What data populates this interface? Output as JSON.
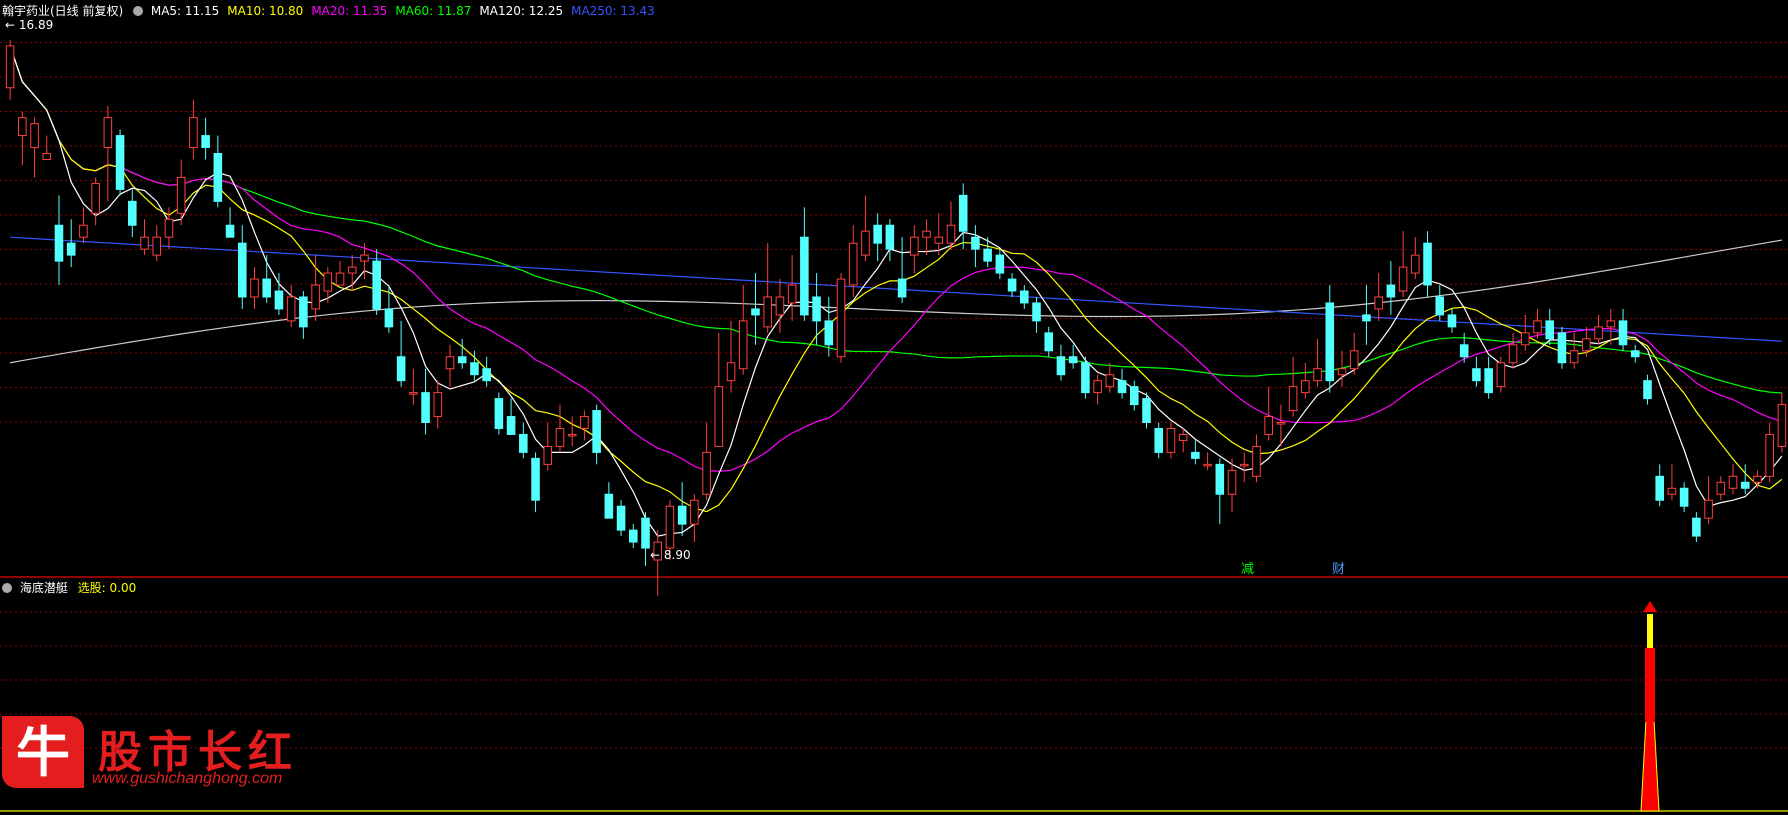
{
  "header": {
    "title": "翰宇药业(日线 前复权)",
    "ma": [
      {
        "label": "MA5: 11.15",
        "color": "#ffffff"
      },
      {
        "label": "MA10: 10.80",
        "color": "#ffff00"
      },
      {
        "label": "MA20: 11.35",
        "color": "#ff00ff"
      },
      {
        "label": "MA60: 11.87",
        "color": "#00ff00"
      },
      {
        "label": "MA120: 12.25",
        "color": "#ffffff"
      },
      {
        "label": "MA250: 13.43",
        "color": "#3355ff"
      }
    ]
  },
  "indicator": {
    "name": "海底潜艇",
    "select_label": "选股: 0.00"
  },
  "markers": {
    "high": "16.89",
    "low": "8.90",
    "event_1": "减",
    "event_2": "财"
  },
  "watermark": {
    "title": "股市长红",
    "badge": "牛",
    "url": "www.gushichanghong.com"
  },
  "colors": {
    "up": "#ff4040",
    "down": "#54ffff",
    "ma5": "#ffffff",
    "ma10": "#ffff00",
    "ma20": "#ff00ff",
    "ma60": "#00ff00",
    "ma120": "#cccccc",
    "ma250": "#3355ff",
    "grid": "#8b0000"
  },
  "chart_data": {
    "type": "candlestick",
    "ylim": [
      8.2,
      17.2
    ],
    "candles": [
      [
        16.1,
        16.8,
        16.9,
        15.9
      ],
      [
        15.3,
        15.6,
        15.7,
        14.8
      ],
      [
        15.1,
        15.5,
        15.6,
        14.6
      ],
      [
        14.9,
        15.0,
        15.3,
        14.9
      ],
      [
        13.8,
        13.2,
        14.3,
        12.8
      ],
      [
        13.5,
        13.3,
        13.9,
        13.1
      ],
      [
        13.6,
        13.8,
        14.1,
        13.5
      ],
      [
        14.0,
        14.5,
        14.6,
        13.8
      ],
      [
        15.1,
        15.6,
        15.8,
        14.2
      ],
      [
        15.3,
        14.4,
        15.4,
        14.3
      ],
      [
        14.2,
        13.8,
        14.4,
        13.6
      ],
      [
        13.4,
        13.6,
        13.9,
        13.3
      ],
      [
        13.3,
        13.6,
        13.8,
        13.2
      ],
      [
        13.6,
        13.9,
        14.1,
        13.4
      ],
      [
        14.0,
        14.6,
        14.9,
        13.8
      ],
      [
        15.1,
        15.6,
        15.9,
        14.9
      ],
      [
        15.3,
        15.1,
        15.6,
        14.9
      ],
      [
        15.0,
        14.2,
        15.3,
        14.1
      ],
      [
        13.8,
        13.6,
        14.1,
        13.6
      ],
      [
        13.5,
        12.6,
        13.8,
        12.4
      ],
      [
        12.6,
        12.9,
        13.1,
        12.4
      ],
      [
        12.9,
        12.6,
        13.3,
        12.5
      ],
      [
        12.7,
        12.4,
        13.0,
        12.3
      ],
      [
        12.2,
        12.6,
        12.8,
        12.1
      ],
      [
        12.6,
        12.1,
        12.7,
        11.9
      ],
      [
        12.4,
        12.8,
        13.3,
        12.2
      ],
      [
        12.7,
        13.0,
        13.1,
        12.5
      ],
      [
        12.8,
        13.0,
        13.2,
        12.8
      ],
      [
        13.0,
        13.1,
        13.3,
        12.7
      ],
      [
        13.2,
        13.3,
        13.5,
        12.9
      ],
      [
        13.2,
        12.4,
        13.4,
        12.3
      ],
      [
        12.4,
        12.1,
        12.8,
        12.0
      ],
      [
        11.6,
        11.2,
        12.2,
        11.1
      ],
      [
        11.0,
        11.0,
        11.4,
        10.8
      ],
      [
        11.0,
        10.5,
        11.4,
        10.3
      ],
      [
        10.6,
        11.0,
        11.2,
        10.4
      ],
      [
        11.4,
        11.6,
        11.8,
        11.1
      ],
      [
        11.6,
        11.5,
        11.9,
        11.4
      ],
      [
        11.5,
        11.3,
        11.7,
        11.2
      ],
      [
        11.4,
        11.2,
        11.6,
        11.1
      ],
      [
        10.9,
        10.4,
        11.0,
        10.3
      ],
      [
        10.6,
        10.3,
        10.9,
        10.3
      ],
      [
        10.3,
        10.0,
        10.5,
        9.9
      ],
      [
        9.9,
        9.2,
        10.0,
        9.0
      ],
      [
        9.8,
        10.1,
        10.5,
        9.7
      ],
      [
        10.1,
        10.4,
        10.8,
        10.0
      ],
      [
        10.3,
        10.3,
        10.6,
        10.1
      ],
      [
        10.4,
        10.6,
        10.7,
        10.2
      ],
      [
        10.7,
        10.0,
        10.8,
        9.8
      ],
      [
        9.3,
        8.9,
        9.5,
        8.9
      ],
      [
        9.1,
        8.7,
        9.2,
        8.6
      ],
      [
        8.7,
        8.5,
        8.8,
        8.4
      ],
      [
        8.9,
        8.4,
        9.0,
        8.1
      ],
      [
        8.2,
        8.5,
        8.7,
        7.6
      ],
      [
        8.4,
        9.1,
        9.2,
        8.2
      ],
      [
        9.1,
        8.8,
        9.5,
        8.6
      ],
      [
        8.8,
        9.2,
        9.3,
        8.5
      ],
      [
        9.3,
        10.0,
        10.5,
        9.2
      ],
      [
        10.1,
        11.1,
        12.0,
        10.1
      ],
      [
        11.2,
        11.5,
        12.2,
        11.0
      ],
      [
        11.4,
        12.2,
        12.8,
        11.3
      ],
      [
        12.4,
        12.3,
        13.0,
        11.8
      ],
      [
        12.1,
        12.6,
        13.5,
        12.0
      ],
      [
        12.3,
        12.6,
        12.9,
        12.0
      ],
      [
        12.5,
        12.8,
        13.3,
        12.2
      ],
      [
        13.6,
        12.3,
        14.1,
        12.2
      ],
      [
        12.6,
        12.2,
        13.0,
        11.8
      ],
      [
        12.2,
        11.8,
        12.6,
        11.6
      ],
      [
        11.6,
        12.9,
        13.0,
        11.5
      ],
      [
        12.8,
        13.5,
        13.8,
        12.6
      ],
      [
        13.3,
        13.7,
        14.3,
        13.2
      ],
      [
        13.8,
        13.5,
        14.0,
        13.2
      ],
      [
        13.8,
        13.4,
        13.9,
        13.2
      ],
      [
        12.9,
        12.6,
        13.6,
        12.5
      ],
      [
        13.3,
        13.6,
        13.8,
        13.0
      ],
      [
        13.6,
        13.7,
        13.9,
        13.3
      ],
      [
        13.5,
        13.6,
        14.0,
        13.3
      ],
      [
        13.5,
        13.8,
        14.2,
        13.4
      ],
      [
        14.3,
        13.7,
        14.5,
        13.4
      ],
      [
        13.6,
        13.4,
        13.8,
        13.1
      ],
      [
        13.4,
        13.2,
        13.6,
        13.1
      ],
      [
        13.3,
        13.0,
        13.4,
        12.9
      ],
      [
        12.9,
        12.7,
        13.0,
        12.6
      ],
      [
        12.7,
        12.5,
        12.8,
        12.4
      ],
      [
        12.5,
        12.2,
        12.6,
        12.0
      ],
      [
        12.0,
        11.7,
        12.1,
        11.6
      ],
      [
        11.6,
        11.3,
        11.8,
        11.2
      ],
      [
        11.6,
        11.5,
        11.8,
        11.4
      ],
      [
        11.5,
        11.0,
        11.6,
        10.9
      ],
      [
        11.0,
        11.2,
        11.3,
        10.8
      ],
      [
        11.1,
        11.3,
        11.5,
        11.0
      ],
      [
        11.2,
        11.0,
        11.4,
        10.9
      ],
      [
        11.1,
        10.8,
        11.2,
        10.7
      ],
      [
        10.9,
        10.5,
        11.0,
        10.4
      ],
      [
        10.4,
        10.0,
        10.5,
        9.9
      ],
      [
        10.0,
        10.4,
        10.5,
        9.9
      ],
      [
        10.2,
        10.3,
        10.4,
        10.0
      ],
      [
        10.0,
        9.9,
        10.2,
        9.8
      ],
      [
        9.8,
        9.8,
        10.0,
        9.7
      ],
      [
        9.8,
        9.3,
        9.9,
        8.8
      ],
      [
        9.3,
        9.7,
        9.9,
        9.0
      ],
      [
        9.8,
        9.8,
        10.0,
        9.5
      ],
      [
        9.6,
        10.1,
        10.3,
        9.5
      ],
      [
        10.3,
        10.6,
        11.1,
        10.2
      ],
      [
        10.5,
        10.5,
        10.8,
        10.1
      ],
      [
        10.7,
        11.1,
        11.6,
        10.6
      ],
      [
        11.0,
        11.2,
        11.5,
        10.9
      ],
      [
        11.2,
        11.4,
        11.9,
        11.1
      ],
      [
        12.5,
        11.2,
        12.8,
        11.0
      ],
      [
        11.3,
        11.4,
        11.7,
        11.1
      ],
      [
        11.4,
        11.7,
        12.0,
        11.3
      ],
      [
        12.3,
        12.2,
        12.8,
        11.8
      ],
      [
        12.4,
        12.6,
        13.0,
        12.2
      ],
      [
        12.8,
        12.6,
        13.2,
        12.3
      ],
      [
        12.7,
        13.1,
        13.7,
        12.6
      ],
      [
        13.0,
        13.3,
        13.6,
        12.9
      ],
      [
        13.5,
        12.8,
        13.7,
        12.6
      ],
      [
        12.6,
        12.3,
        12.8,
        12.2
      ],
      [
        12.3,
        12.1,
        12.4,
        12.0
      ],
      [
        11.8,
        11.6,
        12.0,
        11.5
      ],
      [
        11.4,
        11.2,
        11.6,
        11.1
      ],
      [
        11.4,
        11.0,
        11.6,
        10.9
      ],
      [
        11.1,
        11.5,
        11.6,
        11.0
      ],
      [
        11.5,
        11.8,
        12.0,
        11.4
      ],
      [
        11.8,
        12.0,
        12.3,
        11.7
      ],
      [
        12.0,
        12.2,
        12.4,
        11.9
      ],
      [
        12.2,
        11.9,
        12.4,
        11.8
      ],
      [
        12.0,
        11.5,
        12.1,
        11.4
      ],
      [
        11.5,
        11.7,
        12.0,
        11.4
      ],
      [
        11.7,
        11.9,
        12.1,
        11.6
      ],
      [
        11.9,
        12.1,
        12.3,
        11.8
      ],
      [
        12.1,
        12.2,
        12.4,
        11.8
      ],
      [
        12.2,
        11.8,
        12.4,
        11.7
      ],
      [
        11.7,
        11.6,
        11.8,
        11.5
      ],
      [
        11.2,
        10.9,
        11.3,
        10.8
      ],
      [
        9.6,
        9.2,
        9.8,
        9.1
      ],
      [
        9.3,
        9.4,
        9.8,
        9.2
      ],
      [
        9.4,
        9.1,
        9.5,
        9.0
      ],
      [
        8.9,
        8.6,
        9.0,
        8.5
      ],
      [
        8.9,
        9.2,
        9.6,
        8.8
      ],
      [
        9.3,
        9.5,
        9.6,
        9.2
      ],
      [
        9.4,
        9.6,
        9.8,
        9.3
      ],
      [
        9.5,
        9.4,
        9.8,
        9.3
      ],
      [
        9.5,
        9.6,
        9.7,
        9.4
      ],
      [
        9.6,
        10.3,
        10.5,
        9.5
      ],
      [
        10.1,
        10.8,
        11.0,
        10.0
      ]
    ],
    "indicator_values": {
      "spike_index": 142
    }
  }
}
